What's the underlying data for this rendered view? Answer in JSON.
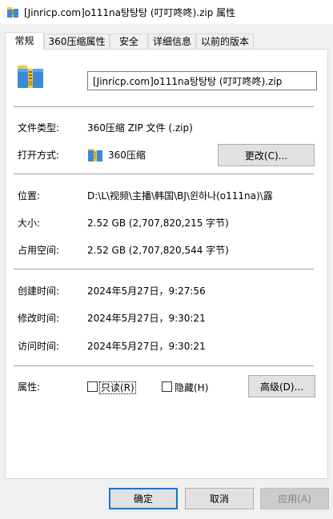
{
  "window": {
    "title": "[Jinricp.com]o111na탕탕탕 (叮叮咚咚).zip 属性",
    "icon": "zip-archive-icon"
  },
  "tabs": [
    {
      "label": "常规",
      "active": true
    },
    {
      "label": "360压缩属性",
      "active": false
    },
    {
      "label": "安全",
      "active": false
    },
    {
      "label": "详细信息",
      "active": false
    },
    {
      "label": "以前的版本",
      "active": false
    }
  ],
  "general": {
    "file_icon": "zip-archive-icon",
    "filename": "[Jinricp.com]o111na탕탕탕 (叮叮咚咚).zip",
    "file_type_label": "文件类型:",
    "file_type_value": "360压缩 ZIP 文件 (.zip)",
    "open_with_label": "打开方式:",
    "open_with_value": "360压缩",
    "change_button": "更改(C)...",
    "location_label": "位置:",
    "location_value": "D:\\L\\视频\\主播\\韩国\\BJ\\윈하나(o111na)\\露",
    "size_label": "大小:",
    "size_value": "2.52 GB (2,707,820,215 字节)",
    "size_on_disk_label": "占用空间:",
    "size_on_disk_value": "2.52 GB (2,707,820,544 字节)",
    "created_label": "创建时间:",
    "created_value": "2024年5月27日，9:27:56",
    "modified_label": "修改时间:",
    "modified_value": "2024年5月27日，9:30:21",
    "accessed_label": "访问时间:",
    "accessed_value": "2024年5月27日，9:30:21",
    "attributes_label": "属性:",
    "readonly_label": "只读(R)",
    "readonly_checked": false,
    "hidden_label": "隐藏(H)",
    "hidden_checked": false,
    "advanced_button": "高级(D)..."
  },
  "footer": {
    "ok": "确定",
    "cancel": "取消",
    "apply": "应用(A)"
  }
}
